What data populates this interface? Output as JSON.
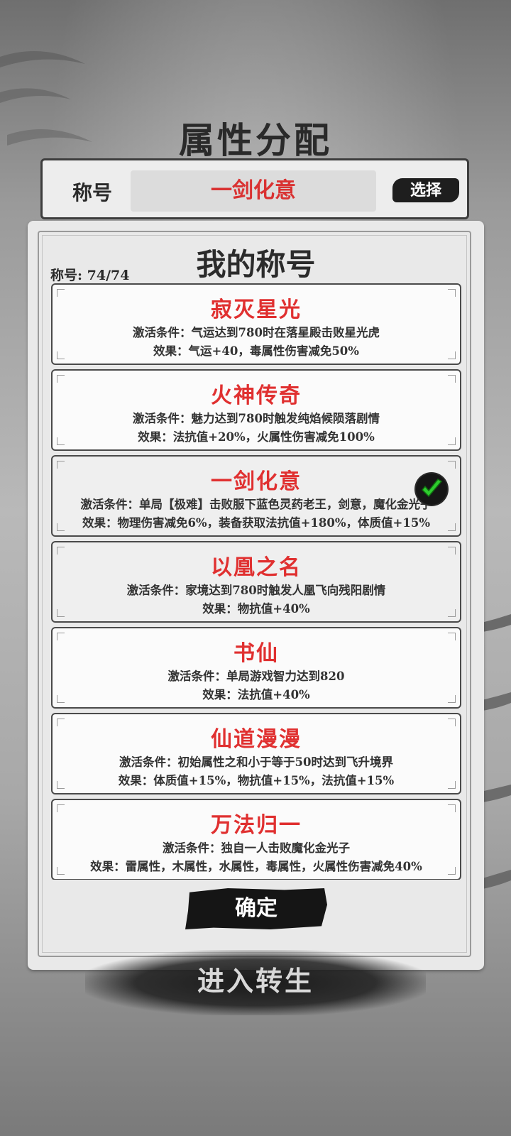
{
  "page_title": "属性分配",
  "title_bar": {
    "label": "称号",
    "current_title": "一剑化意",
    "select_label": "选择"
  },
  "panel": {
    "heading": "我的称号",
    "count_label": "称号: 74/74"
  },
  "titles": [
    {
      "name": "寂灭星光",
      "condition": "激活条件：气运达到780时在落星殿击败星光虎",
      "effect": "效果：气运+40，毒属性伤害减免50%",
      "selected": false
    },
    {
      "name": "火神传奇",
      "condition": "激活条件：魅力达到780时触发纯焰候陨落剧情",
      "effect": "效果：法抗值+20%，火属性伤害减免100%",
      "selected": false
    },
    {
      "name": "一剑化意",
      "condition": "激活条件：单局【极难】击败服下蓝色灵药老王，剑意，魔化金光子",
      "effect": "效果：物理伤害减免6%，装备获取法抗值+180%，体质值+15%",
      "selected": true
    },
    {
      "name": "以凰之名",
      "condition": "激活条件：家境达到780时触发人凰飞向残阳剧情",
      "effect": "效果：物抗值+40%",
      "selected": false
    },
    {
      "name": "书仙",
      "condition": "激活条件：单局游戏智力达到820",
      "effect": "效果：法抗值+40%",
      "selected": false
    },
    {
      "name": "仙道漫漫",
      "condition": "激活条件：初始属性之和小于等于50时达到飞升境界",
      "effect": "效果：体质值+15%，物抗值+15%，法抗值+15%",
      "selected": false
    },
    {
      "name": "万法归一",
      "condition": "激活条件：独自一人击败魔化金光子",
      "effect": "效果：雷属性，木属性，水属性，毒属性，火属性伤害减免40%",
      "selected": false
    }
  ],
  "confirm_label": "确定",
  "rebirth_label": "进入转生",
  "colors": {
    "title_red": "#e03030",
    "ink": "#151515",
    "panel_bg": "#e9e9e9"
  },
  "icons": {
    "selected": "check-icon"
  }
}
